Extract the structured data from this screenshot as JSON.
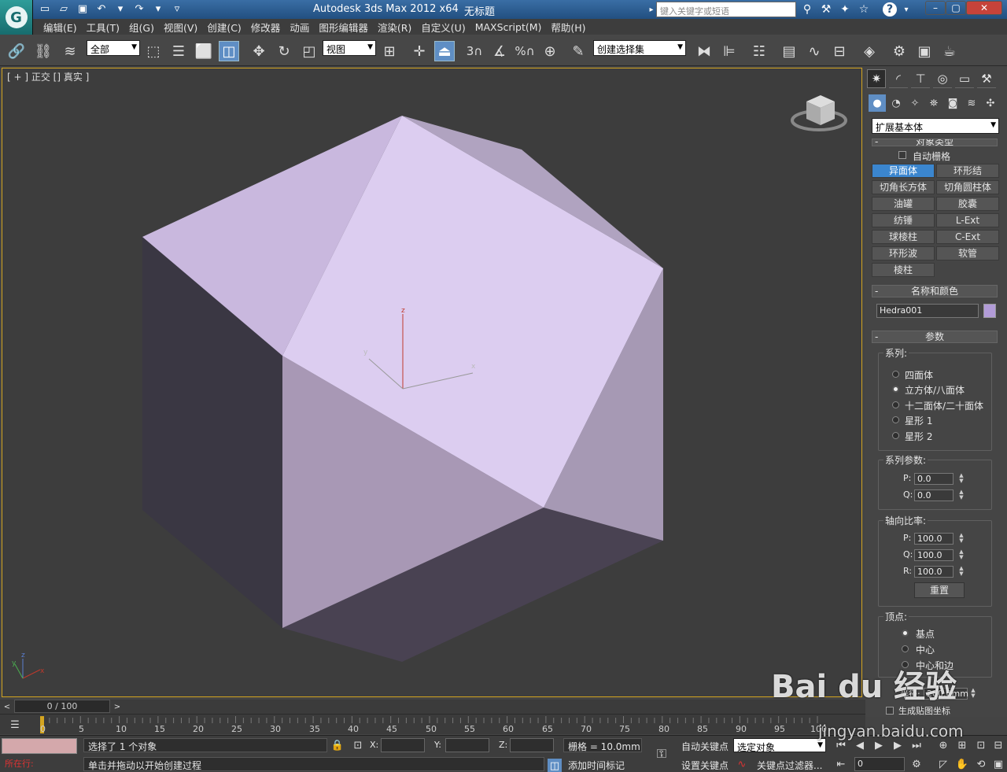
{
  "window": {
    "title": "Autodesk 3ds Max  2012 x64",
    "file": "无标题",
    "search_placeholder": "键入关键字或短语",
    "help": "?"
  },
  "menus": [
    "编辑(E)",
    "工具(T)",
    "组(G)",
    "视图(V)",
    "创建(C)",
    "修改器",
    "动画",
    "图形编辑器",
    "渲染(R)",
    "自定义(U)",
    "MAXScript(M)",
    "帮助(H)"
  ],
  "toolbar": {
    "selection_filter": "全部",
    "ref_coord": "视图",
    "named_selection": "创建选择集",
    "snap_3": "3",
    "percent_snap": "%"
  },
  "viewport": {
    "label": "[ + ] 正交 [] 真实 ]",
    "axis_x": "x",
    "axis_y": "y",
    "axis_z": "z"
  },
  "command_panel": {
    "category": "扩展基本体",
    "object_type_title": "对象类型",
    "autogrid": "自动栅格",
    "buttons": [
      "异面体",
      "环形结",
      "切角长方体",
      "切角圆柱体",
      "油罐",
      "胶囊",
      "纺锤",
      "L-Ext",
      "球棱柱",
      "C-Ext",
      "环形波",
      "软管",
      "棱柱"
    ],
    "name_color_title": "名称和颜色",
    "object_name": "Hedra001",
    "object_color": "#b29cd8",
    "params_title": "参数",
    "family_title": "系列:",
    "family_options": [
      "四面体",
      "立方体/八面体",
      "十二面体/二十面体",
      "星形 1",
      "星形 2"
    ],
    "family_selected": 1,
    "family_params_title": "系列参数:",
    "p_label": "P:",
    "q_label": "Q:",
    "r_label": "R:",
    "family_p": "0.0",
    "family_q": "0.0",
    "axis_ratio_title": "轴向比率:",
    "axis_p": "100.0",
    "axis_q": "100.0",
    "axis_r": "100.0",
    "reset": "重置",
    "vertex_title": "顶点:",
    "vertex_options": [
      "基点",
      "中心",
      "中心和边"
    ],
    "vertex_selected": 0,
    "radius_label": "半径:",
    "radius_value": "200.0mm",
    "gen_uv": "生成贴图坐标"
  },
  "timeline": {
    "slider": "0 / 100",
    "ticks": [
      "0",
      "5",
      "10",
      "15",
      "20",
      "25",
      "30",
      "35",
      "40",
      "45",
      "50",
      "55",
      "60",
      "65",
      "70",
      "75",
      "80",
      "85",
      "90",
      "95",
      "100"
    ]
  },
  "status": {
    "selected": "选择了 1 个对象",
    "prompt": "单击并拖动以开始创建过程",
    "running": "所在行:",
    "x_label": "X:",
    "y_label": "Y:",
    "z_label": "Z:",
    "grid": "栅格 = 10.0mm",
    "auto_key": "自动关键点",
    "set_key": "设置关键点",
    "key_mode": "选定对象",
    "key_filters": "关键点过滤器...",
    "add_time_tag": "添加时间标记",
    "frame": "0"
  },
  "watermark": {
    "brand": "Bai du 经验",
    "url": "jingyan.baidu.com"
  }
}
